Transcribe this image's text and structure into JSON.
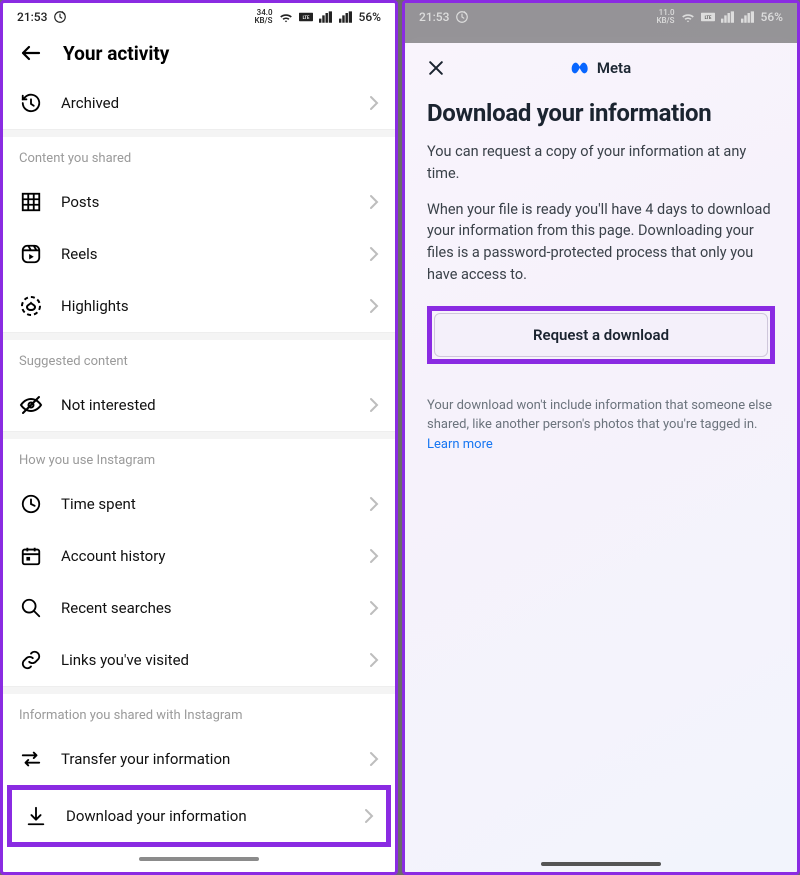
{
  "left": {
    "status": {
      "time": "21:53",
      "net_speed_top": "34.0",
      "net_speed_unit": "KB/S",
      "battery": "56%"
    },
    "header_title": "Your activity",
    "items": {
      "archived": "Archived"
    },
    "sections": {
      "content_shared": {
        "title": "Content you shared",
        "posts": "Posts",
        "reels": "Reels",
        "highlights": "Highlights"
      },
      "suggested": {
        "title": "Suggested content",
        "not_interested": "Not interested"
      },
      "usage": {
        "title": "How you use Instagram",
        "time_spent": "Time spent",
        "account_history": "Account history",
        "recent_searches": "Recent searches",
        "links_visited": "Links you've visited"
      },
      "info_shared": {
        "title": "Information you shared with Instagram",
        "transfer": "Transfer your information",
        "download": "Download your information"
      }
    }
  },
  "right": {
    "status": {
      "time": "21:53",
      "net_speed_top": "11.0",
      "net_speed_unit": "KB/S",
      "battery": "56%"
    },
    "brand": "Meta",
    "title": "Download your information",
    "para1": "You can request a copy of your information at any time.",
    "para2": "When your file is ready you'll have 4 days to download your information from this page. Downloading your files is a password-protected process that only you have access to.",
    "button": "Request a download",
    "footnote": "Your download won't include information that someone else shared, like another person's photos that you're tagged in. ",
    "learn_more": "Learn more"
  }
}
